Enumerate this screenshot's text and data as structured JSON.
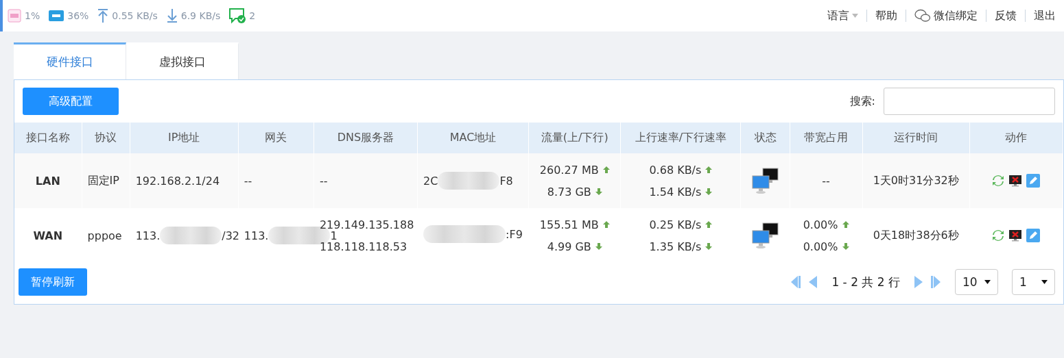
{
  "status_bar": {
    "cpu": "1%",
    "ram": "36%",
    "upload": "0.55 KB/s",
    "download": "6.9 KB/s",
    "online": "2"
  },
  "top_menu": [
    {
      "label": "语言",
      "kind": "dropdown"
    },
    {
      "label": "帮助",
      "kind": "link"
    },
    {
      "label": "微信绑定",
      "kind": "wechat"
    },
    {
      "label": "反馈",
      "kind": "link"
    },
    {
      "label": "退出",
      "kind": "link"
    }
  ],
  "tabs": [
    {
      "label": "硬件接口",
      "selected": true
    },
    {
      "label": "虚拟接口",
      "selected": false
    }
  ],
  "toolbar": {
    "button": "高级配置",
    "search_label": "搜索:"
  },
  "table": {
    "columns": [
      "接口名称",
      "协议",
      "IP地址",
      "网关",
      "DNS服务器",
      "MAC地址",
      "流量(上/下行)",
      "上行速率/下行速率",
      "状态",
      "带宽占用",
      "运行时间",
      "动作"
    ],
    "rows": [
      {
        "name": "LAN",
        "protocol": "固定IP",
        "ip": "192.168.2.1/24",
        "gateway": "--",
        "dns": [
          "--"
        ],
        "mac": {
          "before": "2C",
          "after": "F8"
        },
        "traffic": {
          "up": "260.27 MB",
          "down": "8.73 GB"
        },
        "rate": {
          "up": "0.68 KB/s",
          "down": "1.54 KB/s"
        },
        "bandwidth": {
          "kind": "text",
          "text": "--"
        },
        "uptime": "1天0时31分32秒"
      },
      {
        "name": "WAN",
        "protocol": "pppoe",
        "ip": {
          "before": "113.",
          "after": "/32"
        },
        "gateway": {
          "before": "113.",
          "after": "1"
        },
        "dns": [
          "219.149.135.188",
          "118.118.118.53"
        ],
        "mac": {
          "after": ":F9"
        },
        "traffic": {
          "up": "155.51 MB",
          "down": "4.99 GB"
        },
        "rate": {
          "up": "0.25 KB/s",
          "down": "1.35 KB/s"
        },
        "bandwidth": {
          "kind": "updown",
          "up": "0.00%",
          "down": "0.00%"
        },
        "uptime": "0天18时38分6秒"
      }
    ]
  },
  "footer": {
    "button": "暂停刷新",
    "range": "1 - 2 共 2 行",
    "page_size": "10",
    "page": "1"
  }
}
